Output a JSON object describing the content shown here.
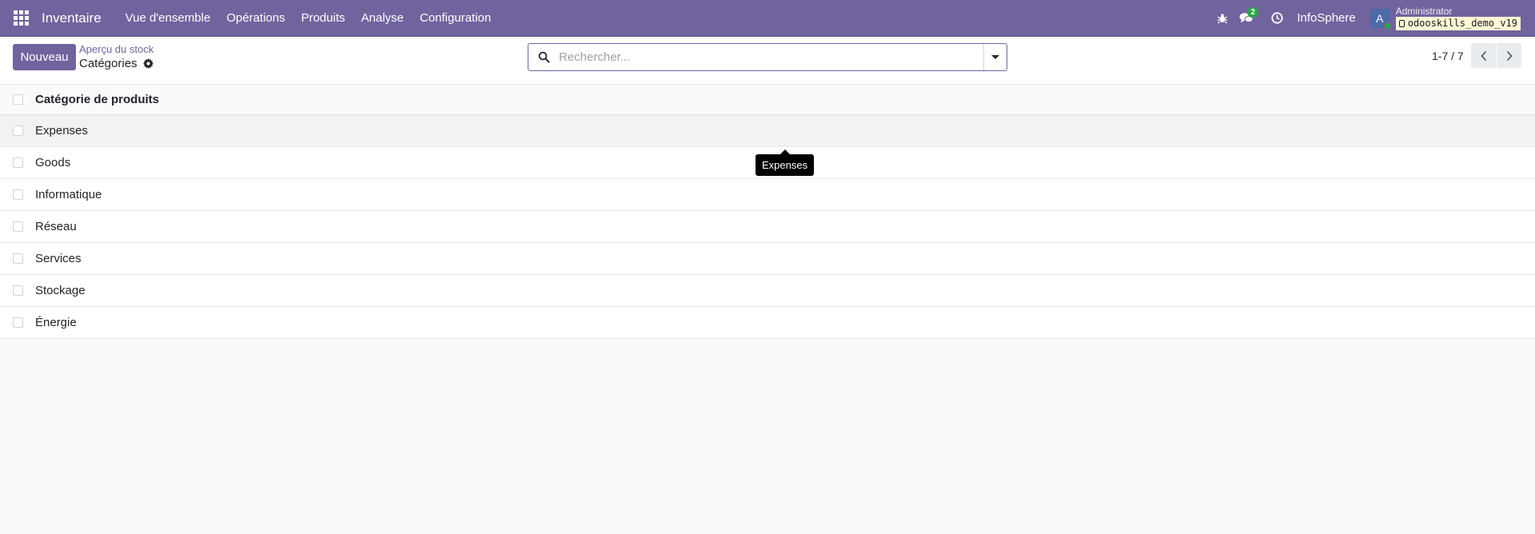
{
  "navbar": {
    "app_name": "Inventaire",
    "menu": [
      "Vue d'ensemble",
      "Opérations",
      "Produits",
      "Analyse",
      "Configuration"
    ],
    "messages_count": "2",
    "company": "InfoSphere",
    "avatar_letter": "A",
    "user": "Administrator",
    "database": "odooskills_demo_v19",
    "icons": [
      "apps-grid-icon",
      "bug-icon",
      "chat-icon",
      "clock-icon",
      "database-icon"
    ],
    "colors": {
      "navbar": "#71639e",
      "online": "#28a745"
    }
  },
  "control": {
    "new_label": "Nouveau",
    "breadcrumb_parent": "Aperçu du stock",
    "breadcrumb_current": "Catégories",
    "search_placeholder": "Rechercher...",
    "pager": "1-7 / 7"
  },
  "list": {
    "header": "Catégorie de produits",
    "rows": [
      "Expenses",
      "Goods",
      "Informatique",
      "Réseau",
      "Services",
      "Stockage",
      "Énergie"
    ]
  },
  "tooltip": "Expenses"
}
